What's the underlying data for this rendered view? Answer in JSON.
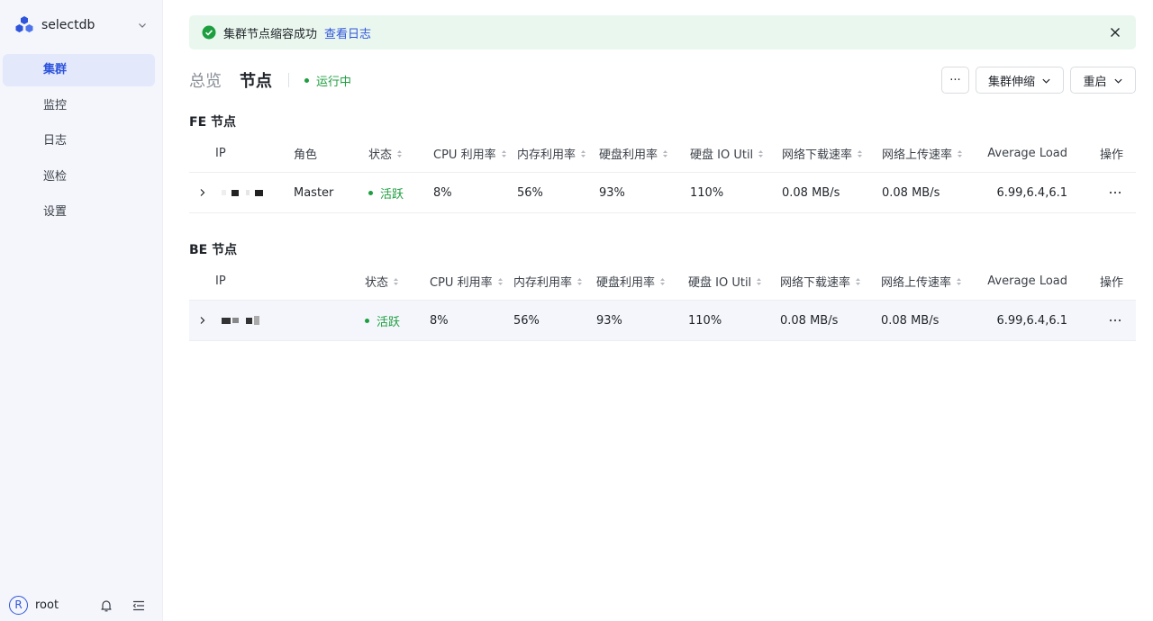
{
  "sidebar": {
    "workspace": "selectdb",
    "items": [
      {
        "label": "集群",
        "active": true
      },
      {
        "label": "监控",
        "active": false
      },
      {
        "label": "日志",
        "active": false
      },
      {
        "label": "巡检",
        "active": false
      },
      {
        "label": "设置",
        "active": false
      }
    ],
    "user": {
      "initial": "R",
      "name": "root"
    }
  },
  "alert": {
    "message": "集群节点缩容成功",
    "link": "查看日志"
  },
  "header": {
    "tabs": [
      {
        "label": "总览",
        "active": false
      },
      {
        "label": "节点",
        "active": true
      }
    ],
    "status": "运行中",
    "more_label": "···",
    "scale_label": "集群伸缩",
    "restart_label": "重启"
  },
  "fe": {
    "title": "FE 节点",
    "columns": [
      "IP",
      "角色",
      "状态",
      "CPU 利用率",
      "内存利用率",
      "硬盘利用率",
      "硬盘 IO Util",
      "网络下载速率",
      "网络上传速率",
      "Average Load",
      "操作"
    ],
    "rows": [
      {
        "ip": "",
        "role": "Master",
        "status": "活跃",
        "cpu": "8%",
        "mem": "56%",
        "disk": "93%",
        "io": "110%",
        "down": "0.08 MB/s",
        "up": "0.08 MB/s",
        "load": "6.99,6.4,6.1",
        "action": "···"
      }
    ]
  },
  "be": {
    "title": "BE 节点",
    "columns": [
      "IP",
      "状态",
      "CPU 利用率",
      "内存利用率",
      "硬盘利用率",
      "硬盘 IO Util",
      "网络下载速率",
      "网络上传速率",
      "Average Load",
      "操作"
    ],
    "rows": [
      {
        "ip": "",
        "status": "活跃",
        "cpu": "8%",
        "mem": "56%",
        "disk": "93%",
        "io": "110%",
        "down": "0.08 MB/s",
        "up": "0.08 MB/s",
        "load": "6.99,6.4,6.1",
        "action": "···"
      }
    ]
  },
  "colors": {
    "accent": "#2e54dc",
    "success": "#1d9e3f",
    "alert_bg": "#eaf7ee",
    "sidebar_bg": "#f4f6fb"
  }
}
